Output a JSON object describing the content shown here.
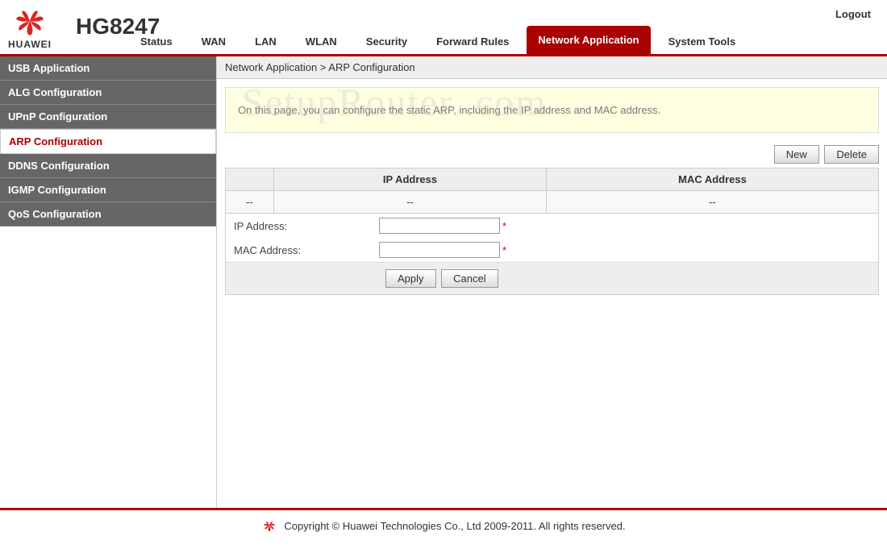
{
  "brand": "HUAWEI",
  "model": "HG8247",
  "logout": "Logout",
  "nav": {
    "items": [
      {
        "label": "Status"
      },
      {
        "label": "WAN"
      },
      {
        "label": "LAN"
      },
      {
        "label": "WLAN"
      },
      {
        "label": "Security"
      },
      {
        "label": "Forward Rules"
      },
      {
        "label": "Network Application"
      },
      {
        "label": "System Tools"
      }
    ]
  },
  "sidebar": {
    "items": [
      {
        "label": "USB Application"
      },
      {
        "label": "ALG Configuration"
      },
      {
        "label": "UPnP Configuration"
      },
      {
        "label": "ARP Configuration"
      },
      {
        "label": "DDNS Configuration"
      },
      {
        "label": "IGMP Configuration"
      },
      {
        "label": "QoS Configuration"
      }
    ]
  },
  "breadcrumb": "Network Application > ARP Configuration",
  "info": "On this page, you can configure the static ARP, including the IP address and MAC address.",
  "buttons": {
    "new": "New",
    "delete": "Delete",
    "apply": "Apply",
    "cancel": "Cancel"
  },
  "table": {
    "headers": {
      "ip": "IP Address",
      "mac": "MAC Address"
    },
    "empty": "--"
  },
  "form": {
    "ip_label": "IP Address:",
    "mac_label": "MAC Address:",
    "ip_value": "",
    "mac_value": ""
  },
  "footer": "Copyright © Huawei Technologies Co., Ltd 2009-2011. All rights reserved.",
  "watermark": "SetupRouter .com"
}
